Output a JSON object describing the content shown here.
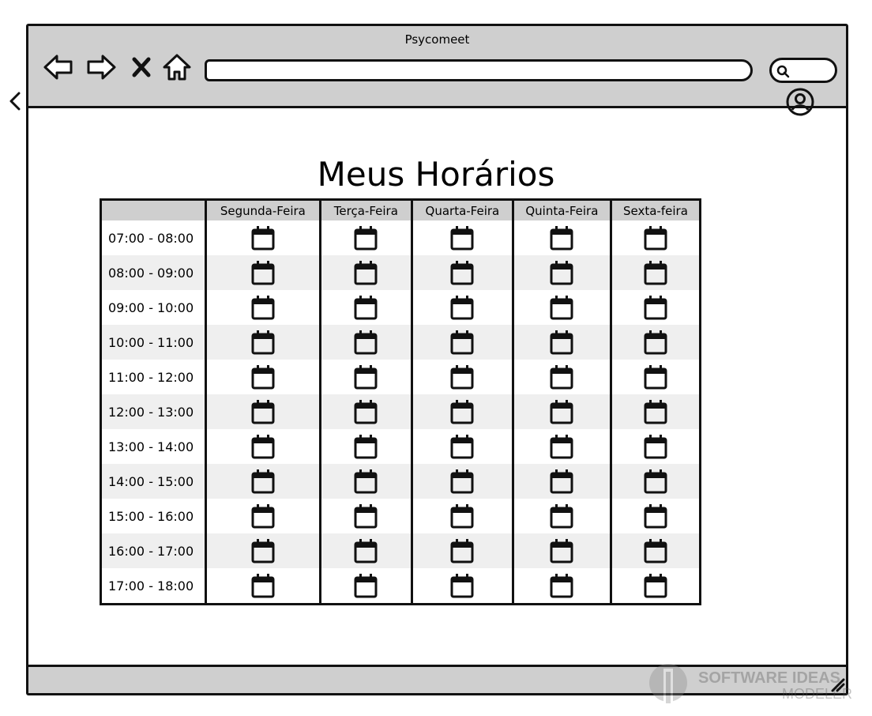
{
  "window": {
    "title": "Psycomeet"
  },
  "browser": {
    "url_value": "",
    "search_value": ""
  },
  "page": {
    "title": "Meus Horários"
  },
  "table": {
    "days": [
      "Segunda-Feira",
      "Terça-Feira",
      "Quarta-Feira",
      "Quinta-Feira",
      "Sexta-feira"
    ],
    "slots": [
      "07:00 - 08:00",
      "08:00 - 09:00",
      "09:00 - 10:00",
      "10:00 - 11:00",
      "11:00 - 12:00",
      "12:00 - 13:00",
      "13:00 - 14:00",
      "14:00 - 15:00",
      "15:00 - 16:00",
      "16:00 - 17:00",
      "17:00 - 18:00"
    ],
    "cell_icon": "calendar-icon"
  },
  "watermark": {
    "line1": "SOFTWARE IDEAS",
    "line2": "MODELER"
  },
  "icons": [
    "back-arrow-icon",
    "forward-arrow-icon",
    "close-icon",
    "home-icon",
    "search-icon",
    "chevron-left-icon",
    "user-icon",
    "calendar-icon",
    "resize-grip-icon"
  ],
  "colors": {
    "chrome": "#cfcfcf",
    "row_alt": "#efefef",
    "stroke": "#111111"
  }
}
